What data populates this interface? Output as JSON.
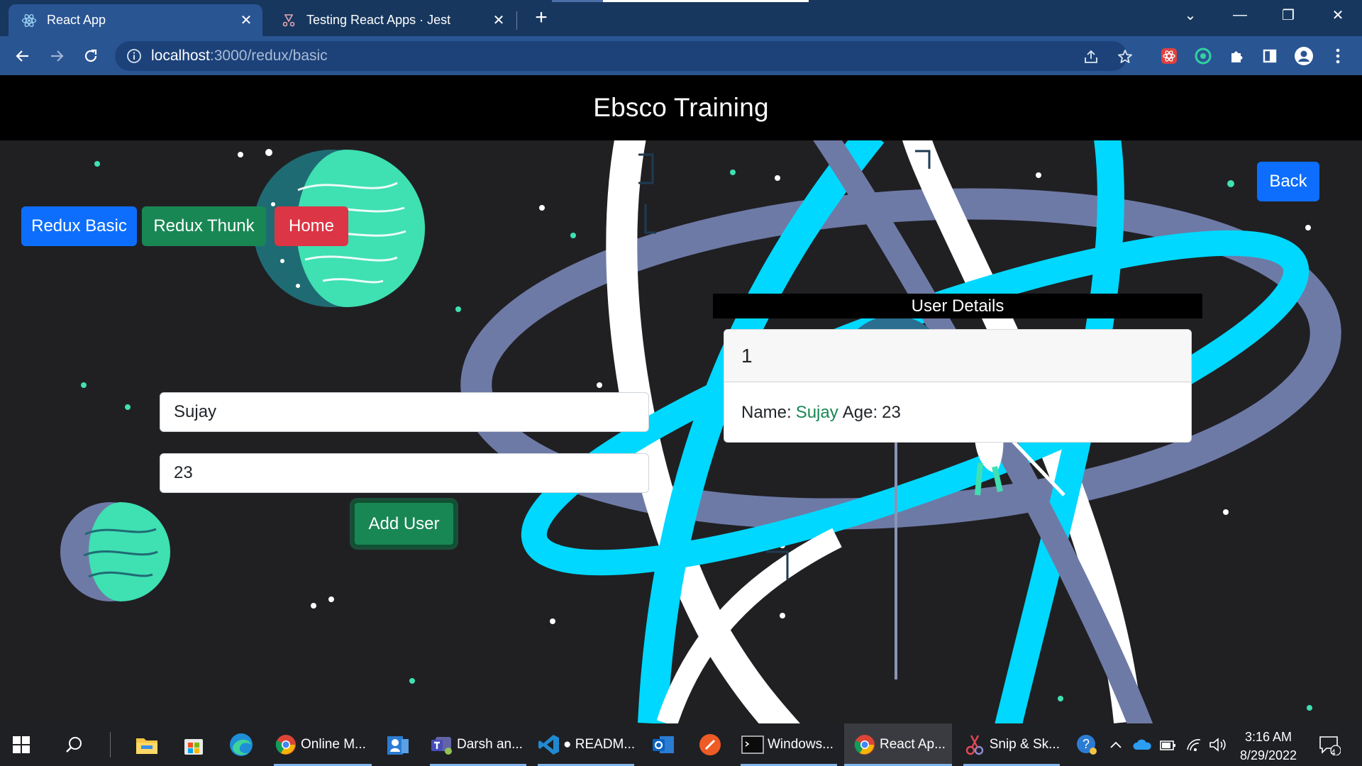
{
  "browser": {
    "tabs": [
      {
        "title": "React App",
        "active": true,
        "icon": "react-icon"
      },
      {
        "title": "Testing React Apps · Jest",
        "active": false,
        "icon": "jest-icon"
      }
    ],
    "url_host": "localhost",
    "url_path": ":3000/redux/basic"
  },
  "app": {
    "title": "Ebsco Training",
    "nav": {
      "redux_basic": "Redux Basic",
      "redux_thunk": "Redux Thunk",
      "home": "Home",
      "back": "Back"
    },
    "form": {
      "name_value": "Sujay",
      "age_value": "23",
      "add_label": "Add User"
    },
    "details": {
      "heading": "User Details",
      "user_id": "1",
      "name_label": "Name:",
      "name_value": "Sujay",
      "age_label": "Age:",
      "age_value": "23"
    }
  },
  "taskbar": {
    "items": [
      {
        "label": "Online M...",
        "icon": "chrome-icon"
      },
      {
        "label": "Darsh an...",
        "icon": "teams-icon"
      },
      {
        "label": "● READM...",
        "icon": "vscode-icon"
      },
      {
        "label": "Windows...",
        "icon": "terminal-icon"
      },
      {
        "label": "React Ap...",
        "icon": "chrome-icon"
      },
      {
        "label": "Snip & Sk...",
        "icon": "snip-icon"
      }
    ],
    "time": "3:16 AM",
    "date": "8/29/2022",
    "notifications": "4"
  },
  "colors": {
    "primary": "#0d6efd",
    "success": "#198754",
    "danger": "#dc3545",
    "react_cyan": "#00d8ff",
    "orbit_gray": "#6e7aa6"
  }
}
